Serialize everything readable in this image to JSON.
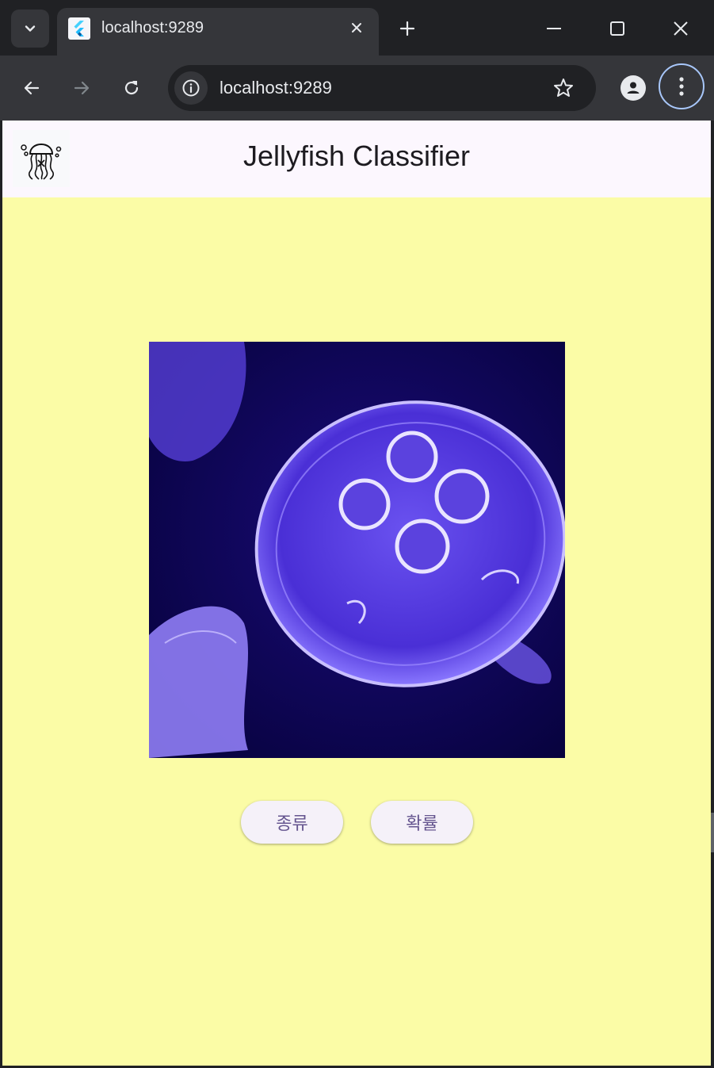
{
  "browser": {
    "tab": {
      "title": "localhost:9289"
    },
    "omnibox": {
      "url": "localhost:9289"
    }
  },
  "app": {
    "title": "Jellyfish Classifier",
    "background_color": "#fbfca6",
    "appbar_color": "#fcf7fe",
    "buttons": {
      "species_label": "종류",
      "probability_label": "확률"
    },
    "button_text_color": "#65558f"
  },
  "icons": {
    "tab_search": "chevron-down-icon",
    "favicon": "flutter-icon",
    "tab_close": "close-icon",
    "new_tab": "plus-icon",
    "minimize": "minimize-icon",
    "maximize": "maximize-icon",
    "close": "close-icon",
    "back": "arrow-left-icon",
    "forward": "arrow-right-icon",
    "reload": "reload-icon",
    "site_info": "info-icon",
    "bookmark": "star-icon",
    "profile": "person-icon",
    "menu": "kebab-menu-icon",
    "logo": "jellyfish-logo-icon"
  }
}
